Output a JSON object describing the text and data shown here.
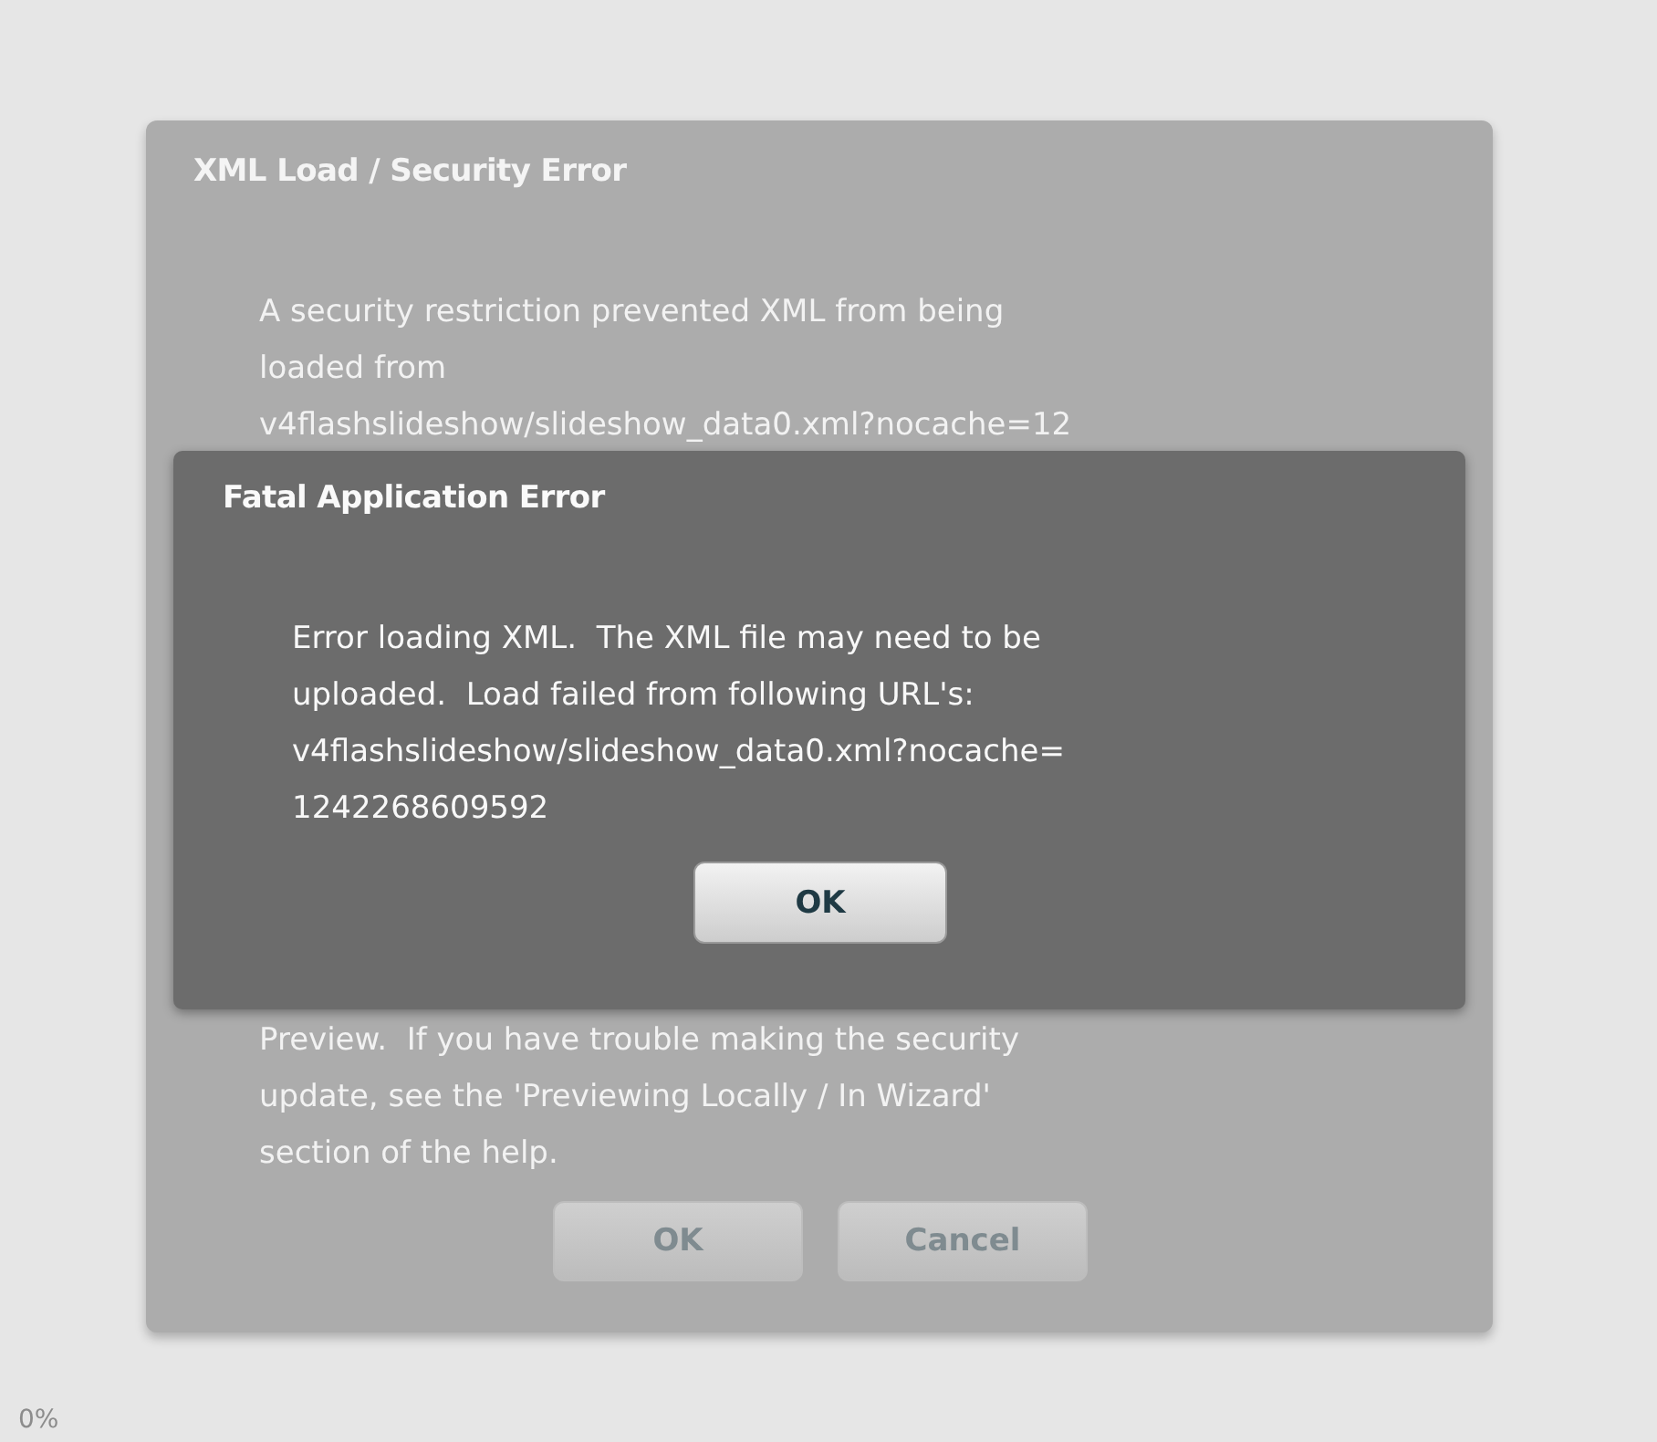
{
  "background_dialog": {
    "title": "XML Load / Security Error",
    "message_top_lines": [
      "A security restriction prevented XML from being",
      "loaded from",
      "v4flashslideshow/slideshow_data0.xml?nocache=12"
    ],
    "message_bottom_lines": [
      "Preview.  If you have trouble making the security",
      "update, see the 'Previewing Locally / In Wizard'",
      "section of the help."
    ],
    "buttons": [
      {
        "label": "OK"
      },
      {
        "label": "Cancel"
      }
    ]
  },
  "foreground_dialog": {
    "title": "Fatal Application Error",
    "message_lines": [
      "Error loading XML.  The XML file may need to be",
      "uploaded.  Load failed from following URL's:",
      "v4flashslideshow/slideshow_data0.xml?nocache=",
      "1242268609592"
    ],
    "button": "OK"
  },
  "progress_label": "0%"
}
